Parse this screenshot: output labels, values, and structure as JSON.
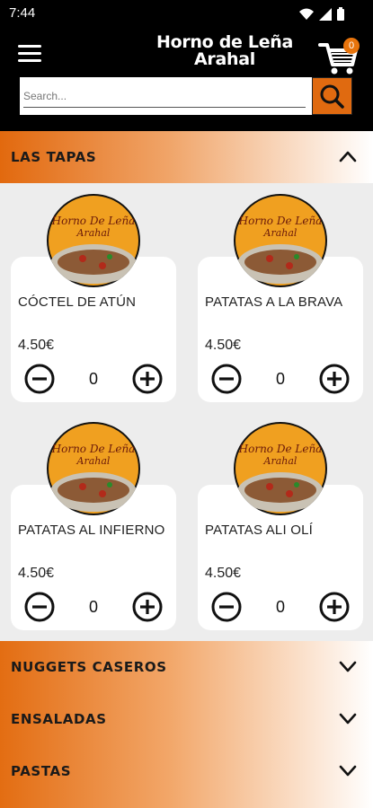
{
  "status_bar": {
    "time": "7:44"
  },
  "header": {
    "title_line1": "Horno de Leña",
    "title_line2": "Arahal",
    "cart_count": "0"
  },
  "search": {
    "placeholder": "Search..."
  },
  "sections": [
    {
      "name": "LAS TAPAS",
      "expanded": true,
      "products": [
        {
          "name": "CÓCTEL DE ATÚN",
          "price": "4.50€",
          "qty": "0"
        },
        {
          "name": "PATATAS A LA BRAVA",
          "price": "4.50€",
          "qty": "0"
        },
        {
          "name": "PATATAS AL INFIERNO",
          "price": "4.50€",
          "qty": "0"
        },
        {
          "name": "PATATAS ALI OLÍ",
          "price": "4.50€",
          "qty": "0"
        }
      ]
    },
    {
      "name": "NUGGETS CASEROS",
      "expanded": false
    },
    {
      "name": "ENSALADAS",
      "expanded": false
    },
    {
      "name": "PASTAS",
      "expanded": false
    }
  ],
  "product_logo_text": "Horno De Leña Arahal",
  "colors": {
    "accent": "#e06a10",
    "header_bg": "#000000",
    "section_bg": "#ededed"
  }
}
